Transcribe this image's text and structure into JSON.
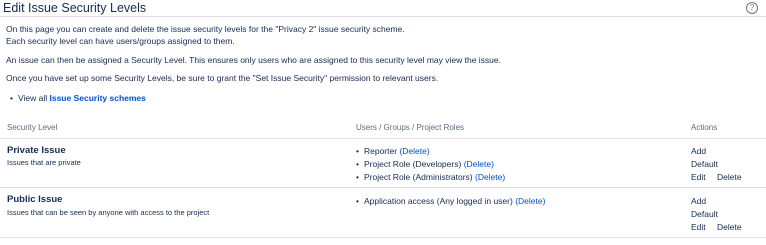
{
  "header": {
    "title": "Edit Issue Security Levels",
    "help_icon_glyph": "?"
  },
  "intro": {
    "line1": "On this page you can create and delete the issue security levels for the \"Privacy 2\" issue security scheme.",
    "line2": "Each security level can have users/groups assigned to them.",
    "line3": "An issue can then be assigned a Security Level. This ensures only users who are assigned to this security level may view the issue.",
    "line4": "Once you have set up some Security Levels, be sure to grant the \"Set Issue Security\" permission to relevant users.",
    "view_all_prefix": "View all ",
    "view_all_link": "Issue Security schemes"
  },
  "table": {
    "headers": {
      "security_level": "Security Level",
      "users": "Users / Groups / Project Roles",
      "actions": "Actions"
    },
    "rows": [
      {
        "name": "Private Issue",
        "description": "Issues that are private",
        "members": [
          {
            "label": "Reporter",
            "delete": "(Delete)"
          },
          {
            "label": "Project Role (Developers)",
            "delete": "(Delete)"
          },
          {
            "label": "Project Role (Administrators)",
            "delete": "(Delete)"
          }
        ],
        "actions": {
          "add": "Add",
          "default": "Default",
          "edit": "Edit",
          "delete": "Delete"
        }
      },
      {
        "name": "Public Issue",
        "description": "Issues that can be seen by anyone with access to the project",
        "members": [
          {
            "label": "Application access (Any logged in user)",
            "delete": "(Delete)"
          }
        ],
        "actions": {
          "add": "Add",
          "default": "Default",
          "edit": "Edit",
          "delete": "Delete"
        }
      }
    ]
  },
  "colors": {
    "text": "#172b4d",
    "link": "#0052cc",
    "muted": "#5e6c84",
    "border": "#dfe1e6"
  }
}
